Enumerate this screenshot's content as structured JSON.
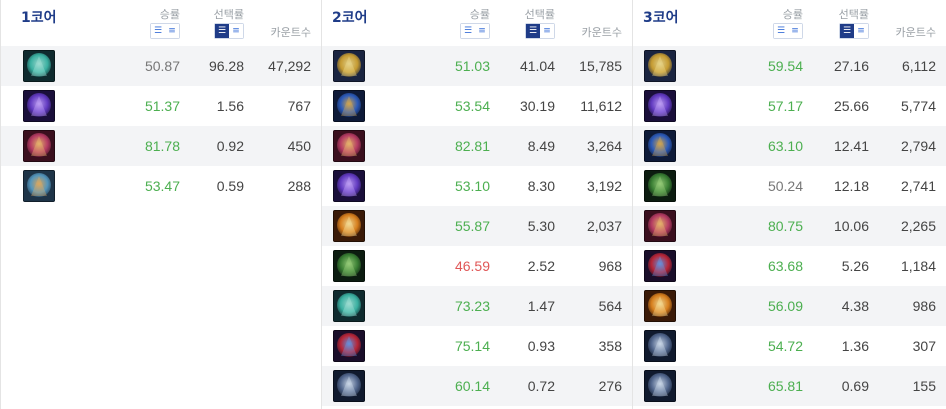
{
  "header": {
    "winrate_label": "승률",
    "pickrate_label": "선택률",
    "count_label": "카운트수",
    "sort_icons": [
      "filter-desc-icon",
      "sort-asc-icon"
    ]
  },
  "colors": {
    "accent": "#1f3c88",
    "win_high": "#4caf50",
    "win_low": "#e05757",
    "neutral": "#777777"
  },
  "sections": [
    {
      "title": "1코어",
      "rows": [
        {
          "icon": "serpent-fang-icon",
          "winrate": "50.87",
          "win_status": "neutral",
          "pickrate": "96.28",
          "count": "47,292"
        },
        {
          "icon": "void-staff-icon",
          "winrate": "51.37",
          "win_status": "high",
          "pickrate": "1.56",
          "count": "767"
        },
        {
          "icon": "book-rune-icon",
          "winrate": "81.78",
          "win_status": "high",
          "pickrate": "0.92",
          "count": "450"
        },
        {
          "icon": "armored-hero-icon",
          "winrate": "53.47",
          "win_status": "high",
          "pickrate": "0.59",
          "count": "288"
        }
      ]
    },
    {
      "title": "2코어",
      "rows": [
        {
          "icon": "gold-chalice-icon",
          "winrate": "51.03",
          "win_status": "high",
          "pickrate": "41.04",
          "count": "15,785"
        },
        {
          "icon": "blue-warrior-icon",
          "winrate": "53.54",
          "win_status": "high",
          "pickrate": "30.19",
          "count": "11,612"
        },
        {
          "icon": "book-rune-icon",
          "winrate": "82.81",
          "win_status": "high",
          "pickrate": "8.49",
          "count": "3,264"
        },
        {
          "icon": "void-staff-icon",
          "winrate": "53.10",
          "win_status": "high",
          "pickrate": "8.30",
          "count": "3,192"
        },
        {
          "icon": "flaming-sword-icon",
          "winrate": "55.87",
          "win_status": "high",
          "pickrate": "5.30",
          "count": "2,037"
        },
        {
          "icon": "green-thorns-icon",
          "winrate": "46.59",
          "win_status": "low",
          "pickrate": "2.52",
          "count": "968"
        },
        {
          "icon": "serpent-fang-icon",
          "winrate": "73.23",
          "win_status": "high",
          "pickrate": "1.47",
          "count": "564"
        },
        {
          "icon": "red-blade-icon",
          "winrate": "75.14",
          "win_status": "high",
          "pickrate": "0.93",
          "count": "358"
        },
        {
          "icon": "silver-armor-icon",
          "winrate": "60.14",
          "win_status": "high",
          "pickrate": "0.72",
          "count": "276"
        }
      ]
    },
    {
      "title": "3코어",
      "rows": [
        {
          "icon": "gold-chalice-icon",
          "winrate": "59.54",
          "win_status": "high",
          "pickrate": "27.16",
          "count": "6,112"
        },
        {
          "icon": "void-staff-icon",
          "winrate": "57.17",
          "win_status": "high",
          "pickrate": "25.66",
          "count": "5,774"
        },
        {
          "icon": "blue-warrior-icon",
          "winrate": "63.10",
          "win_status": "high",
          "pickrate": "12.41",
          "count": "2,794"
        },
        {
          "icon": "green-thorns-icon",
          "winrate": "50.24",
          "win_status": "neutral",
          "pickrate": "12.18",
          "count": "2,741"
        },
        {
          "icon": "book-rune-icon",
          "winrate": "80.75",
          "win_status": "high",
          "pickrate": "10.06",
          "count": "2,265"
        },
        {
          "icon": "red-blade-icon",
          "winrate": "63.68",
          "win_status": "high",
          "pickrate": "5.26",
          "count": "1,184"
        },
        {
          "icon": "flaming-sword-icon",
          "winrate": "56.09",
          "win_status": "high",
          "pickrate": "4.38",
          "count": "986"
        },
        {
          "icon": "silver-armor-icon",
          "winrate": "54.72",
          "win_status": "high",
          "pickrate": "1.36",
          "count": "307"
        },
        {
          "icon": "silver-armor-icon",
          "winrate": "65.81",
          "win_status": "high",
          "pickrate": "0.69",
          "count": "155"
        }
      ]
    }
  ]
}
